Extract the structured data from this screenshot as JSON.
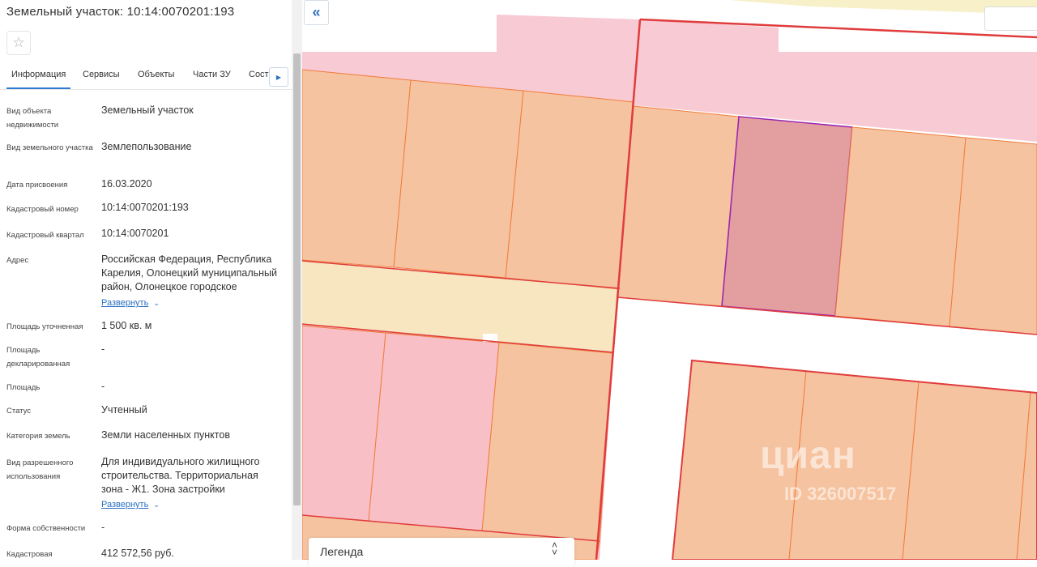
{
  "panel": {
    "title": "Земельный участок: 10:14:0070201:193",
    "favorite_icon": "star-outline-icon",
    "tabs": [
      {
        "label": "Информация",
        "active": true
      },
      {
        "label": "Сервисы"
      },
      {
        "label": "Объекты"
      },
      {
        "label": "Части ЗУ"
      },
      {
        "label": "Соста"
      }
    ],
    "tab_scroll_icon": "triangle-right-icon",
    "fields": [
      {
        "label": "Вид объекта недвижимости",
        "value": "Земельный участок"
      },
      {
        "label": "Вид земельного участка",
        "value": "Землепользование"
      },
      {
        "label": "Дата присвоения",
        "value": "16.03.2020"
      },
      {
        "label": "Кадастровый номер",
        "value": "10:14:0070201:193"
      },
      {
        "label": "Кадастровый квартал",
        "value": "10:14:0070201"
      },
      {
        "label": "Адрес",
        "value": "Российская Федерация, Республика Карелия, Олонецкий муниципальный район, Олонецкое городское",
        "expand": "Развернуть"
      },
      {
        "label": "Площадь уточненная",
        "value": "1 500 кв. м"
      },
      {
        "label": "Площадь декларированная",
        "value": "-"
      },
      {
        "label": "Площадь",
        "value": "-"
      },
      {
        "label": "Статус",
        "value": "Учтенный"
      },
      {
        "label": "Категория земель",
        "value": "Земли населенных пунктов"
      },
      {
        "label": "Вид разрешенного использования",
        "value": "Для индивидуального жилищного строительства. Территориальная зона - Ж1. Зона застройки",
        "expand": "Развернуть"
      },
      {
        "label": "Форма собственности",
        "value": "-"
      },
      {
        "label": "Кадастровая",
        "value": "412 572,56 руб."
      }
    ]
  },
  "map": {
    "collapse_icon": "double-chevron-left-icon",
    "legend_title": "Легенда",
    "legend_toggle_icon": "chevron-updown-icon",
    "watermark_logo": "циан",
    "watermark_id": "ID 326007517",
    "colors": {
      "parcel_fill": "#f6c3a0",
      "parcel_border": "#f07d3c",
      "quarter_fill": "#f8cad4",
      "quarter_border": "#e03c3c",
      "road_fill": "#f7e6c0",
      "selected_fill": "#e39ea0",
      "selected_border": "#9c27b0"
    }
  }
}
